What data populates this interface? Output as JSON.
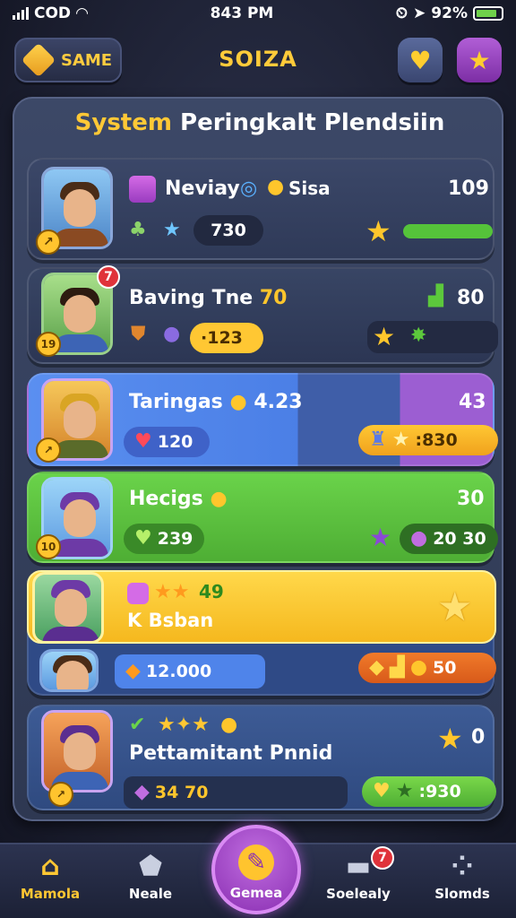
{
  "status_bar": {
    "carrier": "COD",
    "time": "843 PM",
    "battery": "92%"
  },
  "top_bar": {
    "game_button_label": "SAME",
    "title": "SOIZA"
  },
  "panel": {
    "title_prefix": "System",
    "title_rest": "Peringkalt Plendsiin"
  },
  "rows": [
    {
      "name": "Neviay",
      "tag": "Sisa",
      "score": "109",
      "pill": "730",
      "level": ""
    },
    {
      "name": "Baving Tne",
      "name_value": "70",
      "score": "80",
      "pill": "·123",
      "level": "19",
      "badge": "7"
    },
    {
      "name": "Taringas",
      "name_value": "4.23",
      "score": "43",
      "pill": "120",
      "right_pill": ":830",
      "level": ""
    },
    {
      "name": "Hecigs",
      "score": "30",
      "pill": "239",
      "right_pill": "20 30",
      "level": "10"
    },
    {
      "name": "K Bsban",
      "top_value": "49",
      "pill": "12.000",
      "right_pill": "50"
    },
    {
      "name": "Pettamitant Pnnid",
      "score": "0",
      "pill": "34 70",
      "right_pill": ":930"
    }
  ],
  "nav": [
    {
      "label": "Mamola",
      "icon": "home-icon"
    },
    {
      "label": "Neale",
      "icon": "house-icon"
    },
    {
      "label": "Gemea",
      "icon": "play-icon"
    },
    {
      "label": "Soelealy",
      "icon": "chat-icon",
      "badge": "7"
    },
    {
      "label": "Slomds",
      "icon": "grid-icon"
    }
  ],
  "colors": {
    "accent": "#ffc836",
    "row_green": "#5cbf3c",
    "row_yellow": "#ffc733",
    "row_purple": "#9c5ed2"
  }
}
